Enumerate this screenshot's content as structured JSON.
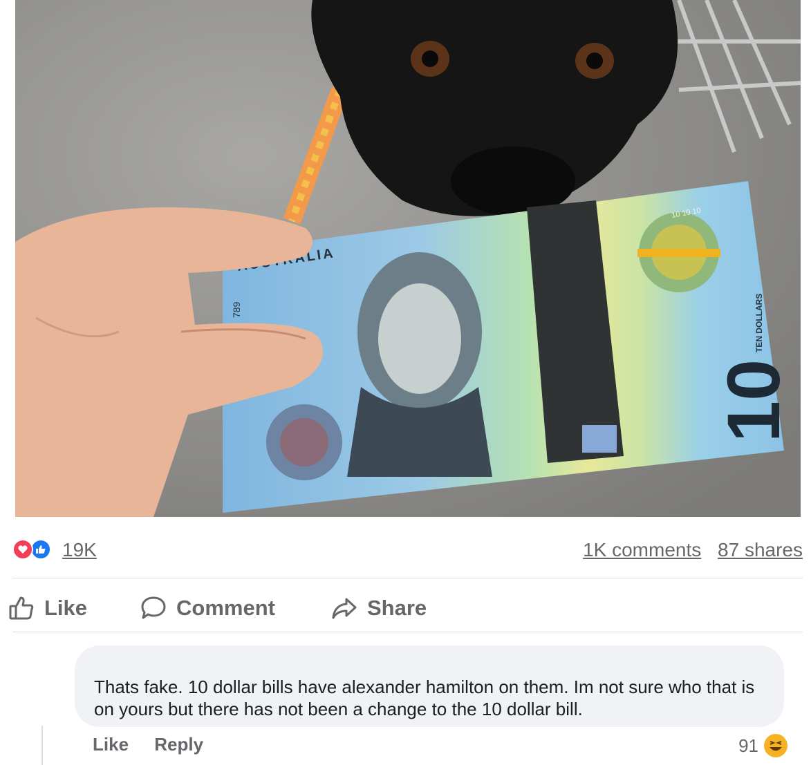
{
  "post_image": {
    "bill_country": "AUSTRALIA",
    "bill_denomination": "10",
    "bill_side_text": "TEN DOLLARS",
    "bill_serial_fragment": "789",
    "bill_small_numbers": "10 10 10"
  },
  "stats": {
    "reaction_count": "19K",
    "comments": "1K comments",
    "shares": "87 shares"
  },
  "actions": {
    "like": "Like",
    "comment": "Comment",
    "share": "Share"
  },
  "comment": {
    "text": "Thats fake. 10 dollar bills have alexander hamilton on them. Im not sure who that is on yours but there has not been a change to the 10 dollar bill.",
    "like_label": "Like",
    "reply_label": "Reply",
    "reaction_count": "91"
  },
  "colors": {
    "like_blue": "#1877f2",
    "love_red": "#f33e58",
    "haha_yellow": "#f7b125"
  }
}
